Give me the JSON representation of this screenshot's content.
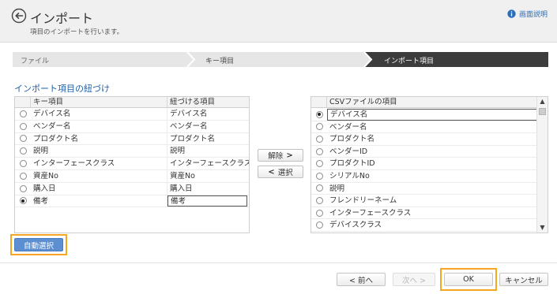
{
  "header": {
    "title": "インポート",
    "subtitle": "項目のインポートを行います。",
    "help_label": "画面説明"
  },
  "steps": [
    "ファイル",
    "キー項目",
    "インポート項目"
  ],
  "section_title": "インポート項目の紐づけ",
  "left_grid": {
    "headers": [
      "キー項目",
      "紐づける項目"
    ],
    "rows": [
      {
        "key": "デバイス名",
        "mapped": "デバイス名",
        "selected": false
      },
      {
        "key": "ベンダー名",
        "mapped": "ベンダー名",
        "selected": false
      },
      {
        "key": "プロダクト名",
        "mapped": "プロダクト名",
        "selected": false
      },
      {
        "key": "説明",
        "mapped": "説明",
        "selected": false
      },
      {
        "key": "インターフェースクラス",
        "mapped": "インターフェースクラス",
        "selected": false
      },
      {
        "key": "資産No",
        "mapped": "資産No",
        "selected": false
      },
      {
        "key": "購入日",
        "mapped": "購入日",
        "selected": false
      },
      {
        "key": "備考",
        "mapped": "備考",
        "selected": true
      }
    ]
  },
  "middle_buttons": {
    "release": "解除",
    "select": "選択"
  },
  "right_grid": {
    "header": "CSVファイルの項目",
    "rows": [
      {
        "label": "デバイス名",
        "selected": true
      },
      {
        "label": "ベンダー名",
        "selected": false
      },
      {
        "label": "プロダクト名",
        "selected": false
      },
      {
        "label": "ベンダーID",
        "selected": false
      },
      {
        "label": "プロダクトID",
        "selected": false
      },
      {
        "label": "シリアルNo",
        "selected": false
      },
      {
        "label": "説明",
        "selected": false
      },
      {
        "label": "フレンドリーネーム",
        "selected": false
      },
      {
        "label": "インターフェースクラス",
        "selected": false
      },
      {
        "label": "デバイスクラス",
        "selected": false
      },
      {
        "label": "",
        "selected": false
      }
    ]
  },
  "auto_select_label": "自動選択",
  "footer": {
    "prev": "< 前へ",
    "next": "次へ >",
    "ok": "OK",
    "cancel": "キャンセル"
  },
  "colors": {
    "accent": "#1f5fa8",
    "active_step": "#3c3c3c",
    "highlight": "#f5a623",
    "primary_button": "#5b8fd2"
  }
}
